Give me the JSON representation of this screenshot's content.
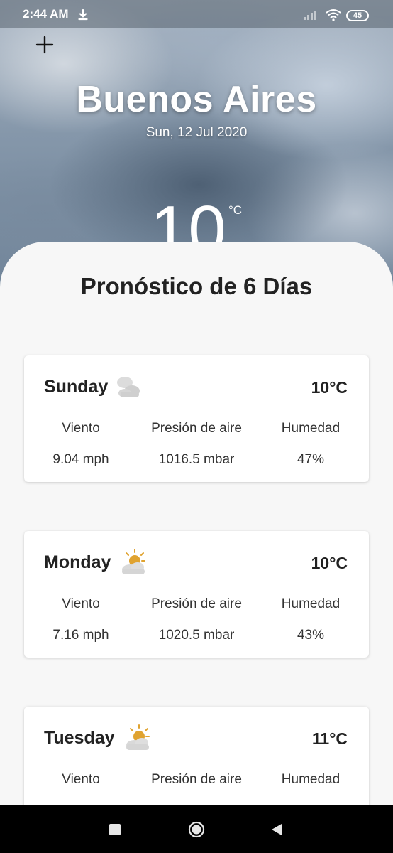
{
  "status_bar": {
    "time": "2:44 AM",
    "battery": "45",
    "icons": [
      "download-icon",
      "signal-icon",
      "wifi-icon",
      "battery-icon"
    ]
  },
  "header": {
    "add_icon": "plus-icon",
    "city": "Buenos Aires",
    "date": "Sun, 12 Jul 2020",
    "temperature": "10",
    "unit": "°C"
  },
  "forecast": {
    "title": "Pronóstico de 6 Días",
    "labels": {
      "wind": "Viento",
      "pressure": "Presión de aire",
      "humidity": "Humedad"
    },
    "days": [
      {
        "day": "Sunday",
        "icon": "cloudy-icon",
        "temp": "10°C",
        "wind": "9.04 mph",
        "pressure": "1016.5 mbar",
        "humidity": "47%"
      },
      {
        "day": "Monday",
        "icon": "partly-sunny-icon",
        "temp": "10°C",
        "wind": "7.16 mph",
        "pressure": "1020.5 mbar",
        "humidity": "43%"
      },
      {
        "day": "Tuesday",
        "icon": "partly-sunny-icon",
        "temp": "11°C",
        "wind": "",
        "pressure": "",
        "humidity": ""
      }
    ]
  },
  "nav_bar": {
    "icons": [
      "recents-icon",
      "home-icon",
      "back-icon"
    ]
  },
  "colors": {
    "sheet_background": "#f7f7f7",
    "card_background": "#ffffff",
    "text_dark": "#222222",
    "sun": "#e0a330"
  }
}
